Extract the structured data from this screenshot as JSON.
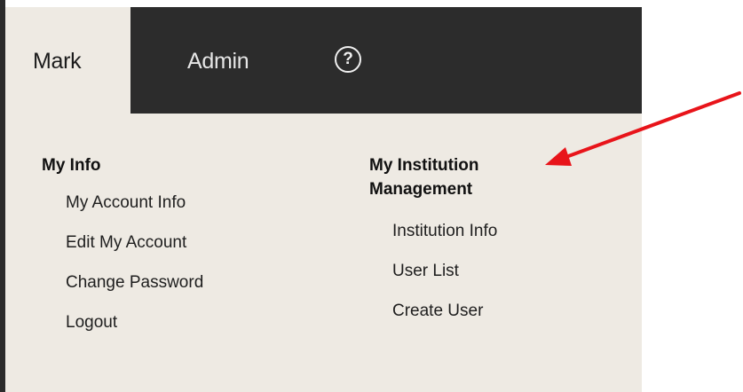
{
  "tabs": {
    "user_tab_label": "Mark",
    "admin_tab_label": "Admin",
    "help_icon_glyph": "?"
  },
  "my_info": {
    "heading": "My Info",
    "links": [
      "My Account Info",
      "Edit My Account",
      "Change Password",
      "Logout"
    ]
  },
  "institution": {
    "heading_line1": "My Institution",
    "heading_line2": "Management",
    "links": [
      "Institution Info",
      "User List",
      "Create User"
    ]
  },
  "icons": {
    "help": "help-icon",
    "annotation": "red-arrow-icon"
  },
  "colors": {
    "topbar": "#2c2c2c",
    "panel": "#eeeae3",
    "annotation_arrow": "#e8141a"
  }
}
